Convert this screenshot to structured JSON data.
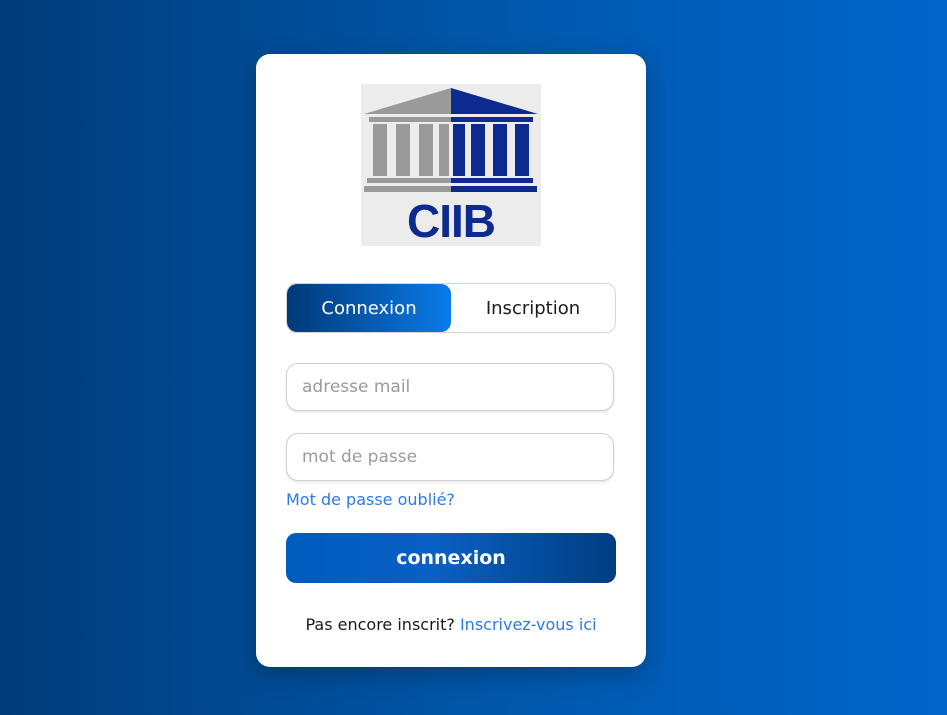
{
  "logo": {
    "text": "CIIB",
    "icon": "temple-columns-logo",
    "colors": {
      "left": "#9a9a9a",
      "right": "#0d2a8e",
      "background": "#ececec"
    }
  },
  "tabs": [
    {
      "label": "Connexion",
      "active": true
    },
    {
      "label": "Inscription",
      "active": false
    }
  ],
  "form": {
    "email_placeholder": "adresse mail",
    "password_placeholder": "mot de passe",
    "forgot_label": "Mot de passe oublié?",
    "submit_label": "connexion"
  },
  "footer": {
    "prompt": "Pas encore inscrit?",
    "link_label": "Inscrivez-vous ici"
  },
  "colors": {
    "accent": "#2c7be5",
    "brand_dark": "#003c7a",
    "brand_light": "#0066cc"
  }
}
